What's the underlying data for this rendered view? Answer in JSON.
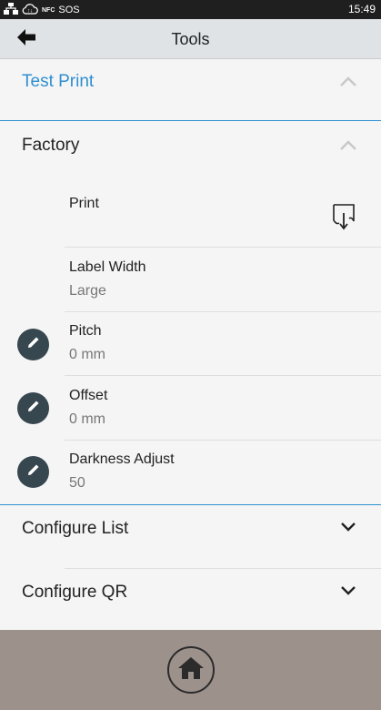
{
  "status_bar": {
    "sos_label": "SOS",
    "nfc_label": "NFC",
    "time": "15:49",
    "icons": [
      "network-icon",
      "cloud-icon",
      "nfc-icon"
    ]
  },
  "header": {
    "title": "Tools"
  },
  "sections": {
    "test_print": {
      "title": "Test Print",
      "expanded": true
    },
    "factory": {
      "title": "Factory",
      "expanded": true,
      "rows": {
        "print": {
          "label": "Print",
          "icon": "print-label-icon"
        },
        "label_width": {
          "label": "Label Width",
          "value": "Large"
        },
        "pitch": {
          "label": "Pitch",
          "value": "0 mm",
          "editable": true
        },
        "offset": {
          "label": "Offset",
          "value": "0 mm",
          "editable": true
        },
        "darkness": {
          "label": "Darkness Adjust",
          "value": "50",
          "editable": true
        }
      }
    },
    "configure_list": {
      "title": "Configure List",
      "expanded": false
    },
    "configure_qr": {
      "title": "Configure QR",
      "expanded": false
    }
  },
  "colors": {
    "accent": "#2e8fd0",
    "app_bar": "#dfe3e6",
    "edit_button": "#37474f",
    "bottom_bar": "#9d918c"
  }
}
